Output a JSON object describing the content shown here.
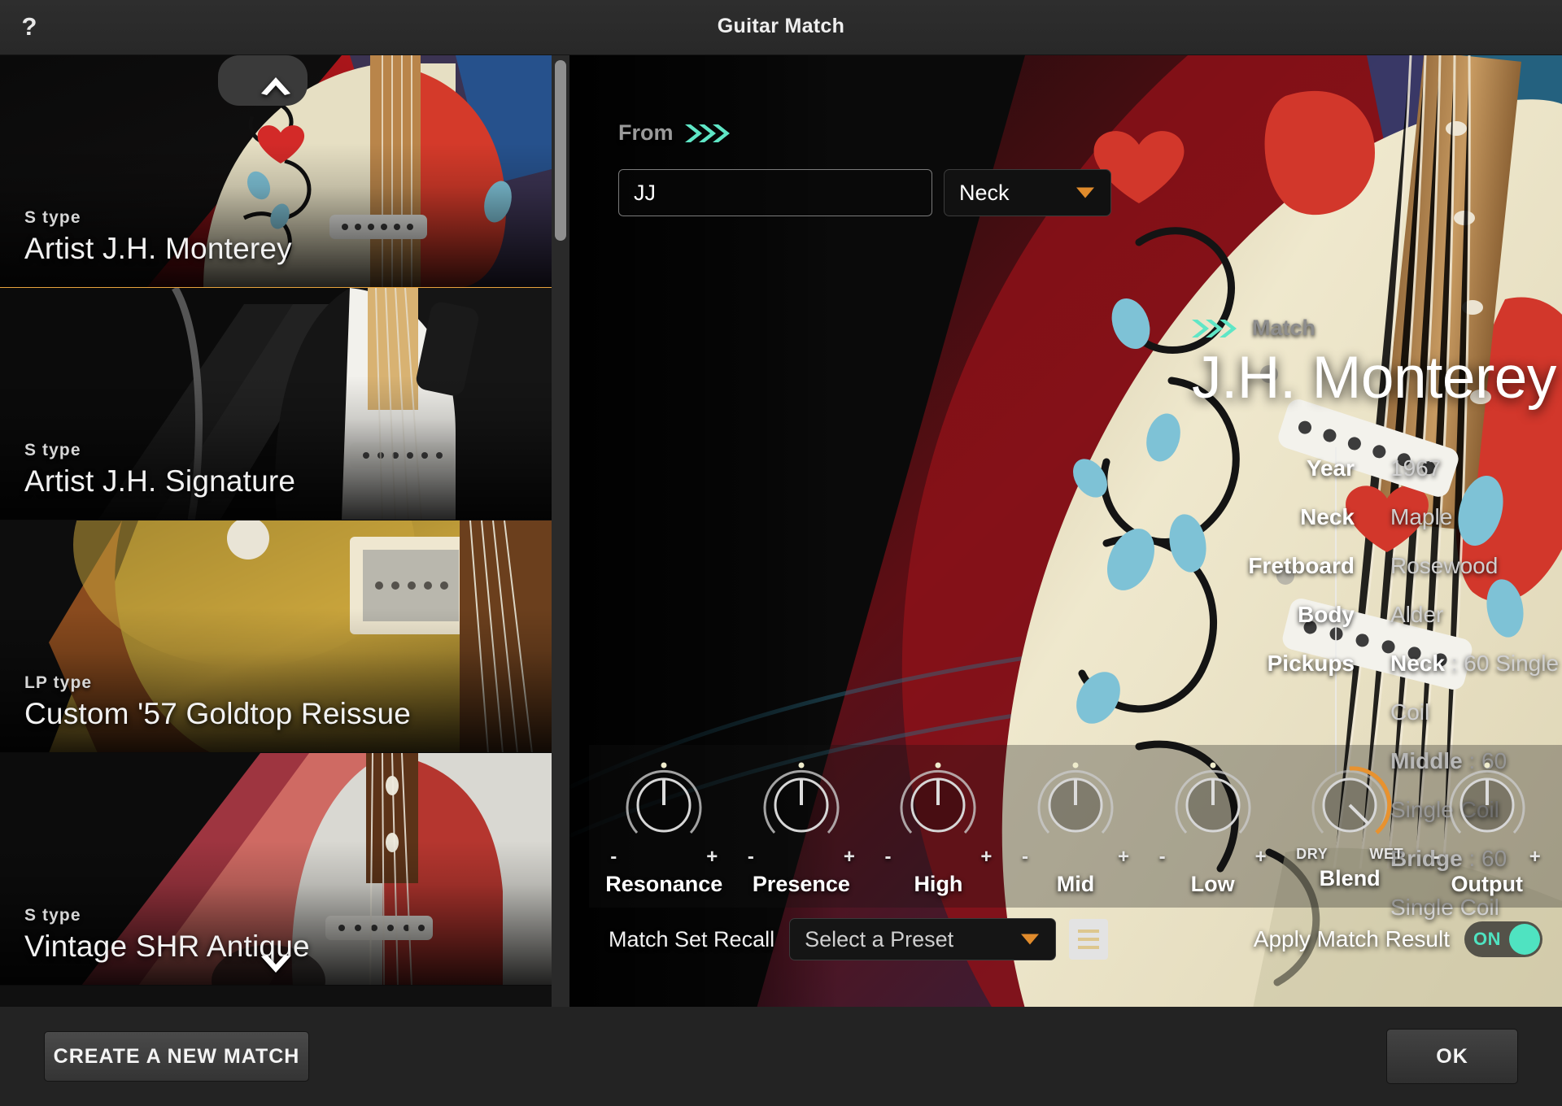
{
  "window": {
    "title": "Guitar Match",
    "help_icon": "?"
  },
  "guitar_list": {
    "scroll_up_icon": "chevron-up",
    "scroll_down_icon": "chevron-down",
    "items": [
      {
        "type": "S type",
        "name": "Artist J.H. Monterey",
        "selected": true
      },
      {
        "type": "S type",
        "name": "Artist J.H. Signature",
        "selected": false
      },
      {
        "type": "LP type",
        "name": "Custom '57 Goldtop Reissue",
        "selected": false
      },
      {
        "type": "S type",
        "name": "Vintage SHR Antique",
        "selected": false
      }
    ]
  },
  "detail": {
    "from_label": "From",
    "from_arrows_icon": "chevrons-right",
    "source_value": "JJ",
    "source_placeholder": "",
    "pickup_select": {
      "value": "Neck",
      "caret_icon": "caret-down"
    },
    "match_label": "Match",
    "match_arrows_icon": "chevrons-right",
    "match_title": "J.H. Monterey",
    "specs": [
      {
        "key": "Year",
        "value": "1967"
      },
      {
        "key": "Neck",
        "value": "Maple"
      },
      {
        "key": "Fretboard",
        "value": "Rosewood"
      },
      {
        "key": "Body",
        "value": "Alder"
      }
    ],
    "pickups_key": "Pickups",
    "pickups": [
      {
        "position": "Neck",
        "separator": " : ",
        "value": "60 Single Coil"
      },
      {
        "position": "Middle",
        "separator": " : ",
        "value": "60 Single Coil"
      },
      {
        "position": "Bridge",
        "separator": " : ",
        "value": "60 Single Coil"
      }
    ],
    "knobs": [
      {
        "label": "Resonance",
        "min": "-",
        "max": "+",
        "angle": 0,
        "arc": false
      },
      {
        "label": "Presence",
        "min": "-",
        "max": "+",
        "angle": 0,
        "arc": false
      },
      {
        "label": "High",
        "min": "-",
        "max": "+",
        "angle": 0,
        "arc": false
      },
      {
        "label": "Mid",
        "min": "-",
        "max": "+",
        "angle": 0,
        "arc": false
      },
      {
        "label": "Low",
        "min": "-",
        "max": "+",
        "angle": 0,
        "arc": false
      },
      {
        "label": "Blend",
        "min": "DRY",
        "max": "WET",
        "angle": 135,
        "arc": true
      },
      {
        "label": "Output",
        "min": "-",
        "max": "+",
        "angle": 0,
        "arc": false
      }
    ],
    "match_set_recall_label": "Match Set Recall",
    "preset_select": {
      "value": "Select a Preset",
      "caret_icon": "caret-down"
    },
    "preset_list_icon": "list-menu-icon",
    "apply_match_result_label": "Apply Match Result",
    "apply_match_result_state": "ON"
  },
  "footer": {
    "create_label": "CREATE A NEW MATCH",
    "ok_label": "OK"
  },
  "colors": {
    "accent_orange": "#e08b2c",
    "accent_teal": "#4fe3c1",
    "selection_border": "#e8a33d",
    "panel_bg": "#232323"
  }
}
